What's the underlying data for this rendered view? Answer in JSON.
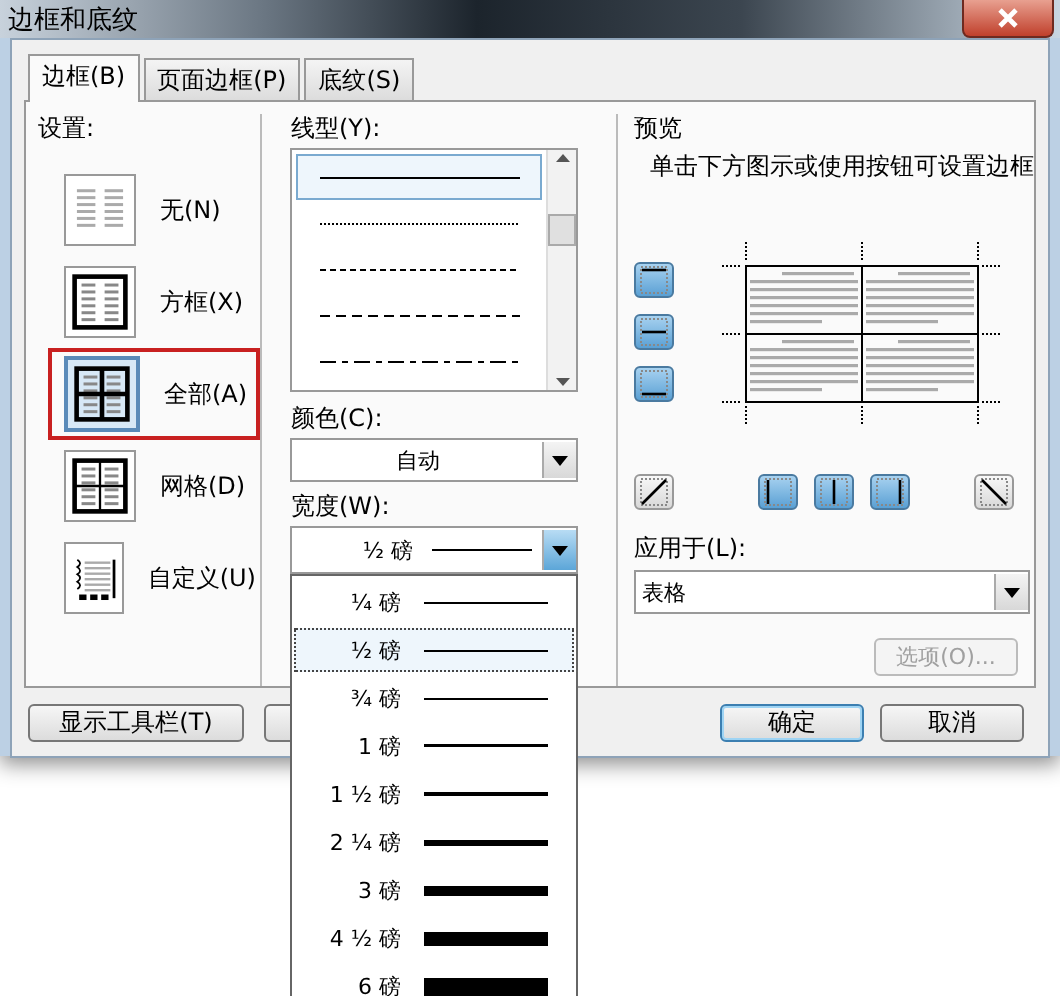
{
  "window": {
    "title": "边框和底纹"
  },
  "tabs": [
    {
      "label": "边框(B)",
      "selected": true
    },
    {
      "label": "页面边框(P)",
      "selected": false
    },
    {
      "label": "底纹(S)",
      "selected": false
    }
  ],
  "settings": {
    "label": "设置:",
    "items": [
      {
        "label": "无(N)",
        "kind": "none",
        "selected": false
      },
      {
        "label": "方框(X)",
        "kind": "box",
        "selected": false
      },
      {
        "label": "全部(A)",
        "kind": "all",
        "selected": true
      },
      {
        "label": "网格(D)",
        "kind": "grid",
        "selected": false
      },
      {
        "label": "自定义(U)",
        "kind": "custom",
        "selected": false
      }
    ]
  },
  "line_style": {
    "label": "线型(Y):",
    "items": [
      {
        "kind": "solid",
        "selected": true
      },
      {
        "kind": "dotted",
        "selected": false
      },
      {
        "kind": "fine-dash",
        "selected": false
      },
      {
        "kind": "dash",
        "selected": false
      },
      {
        "kind": "dash-dot",
        "selected": false
      }
    ]
  },
  "color": {
    "label": "颜色(C):",
    "value": "自动"
  },
  "width": {
    "label": "宽度(W):",
    "value": "½ 磅",
    "options": [
      {
        "label": "¼ 磅",
        "selected": false
      },
      {
        "label": "½ 磅",
        "selected": true
      },
      {
        "label": "¾ 磅",
        "selected": false
      },
      {
        "label": "1 磅",
        "selected": false
      },
      {
        "label": "1 ½ 磅",
        "selected": false
      },
      {
        "label": "2 ¼ 磅",
        "selected": false
      },
      {
        "label": "3 磅",
        "selected": false
      },
      {
        "label": "4 ½ 磅",
        "selected": false
      },
      {
        "label": "6 磅",
        "selected": false
      }
    ]
  },
  "preview": {
    "title": "预览",
    "hint": "单击下方图示或使用按钮可设置边框",
    "side_buttons": [
      {
        "kind": "top",
        "on": true
      },
      {
        "kind": "middle",
        "on": true
      },
      {
        "kind": "bottom",
        "on": true
      }
    ],
    "bottom_buttons": [
      {
        "kind": "diag-up",
        "on": false
      },
      {
        "kind": "left",
        "on": true
      },
      {
        "kind": "center",
        "on": true
      },
      {
        "kind": "right",
        "on": true
      },
      {
        "kind": "diag-down",
        "on": false
      }
    ]
  },
  "apply_to": {
    "label": "应用于(L):",
    "value": "表格"
  },
  "options_button": {
    "label": "选项(O)...",
    "disabled": true
  },
  "buttons": [
    {
      "label": "显示工具栏(T)",
      "kind": "toolbar"
    },
    {
      "kind": "hidden"
    },
    {
      "label": "确定",
      "kind": "ok"
    },
    {
      "label": "取消",
      "kind": "cancel"
    }
  ]
}
